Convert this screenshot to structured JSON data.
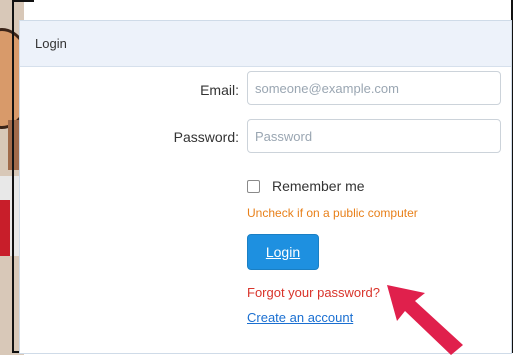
{
  "panel": {
    "title": "Login"
  },
  "form": {
    "email_label": "Email:",
    "email_placeholder": "someone@example.com",
    "email_value": "",
    "password_label": "Password:",
    "password_placeholder": "Password",
    "password_value": "",
    "remember_label": "Remember me",
    "remember_checked": false,
    "hint_text": "Uncheck if on a public computer",
    "login_button": "Login",
    "forgot_link": "Forgot your password?",
    "create_link": "Create an account"
  },
  "colors": {
    "accent": "#1e90e0",
    "hint": "#e8801a",
    "forgot": "#d9342b",
    "link": "#1a6fd1",
    "annotation_arrow": "#e0204c"
  },
  "icons": {
    "annotation": "pointer-arrow-icon"
  }
}
